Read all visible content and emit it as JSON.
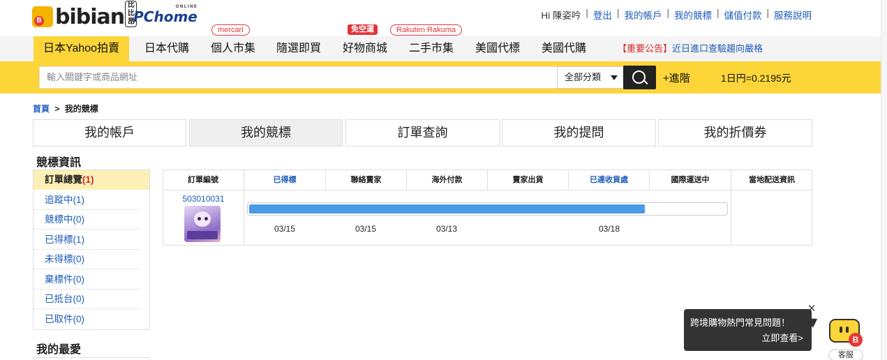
{
  "header": {
    "logo": {
      "bibian": "bibian",
      "small": "比比昂",
      "pchome": "PChome",
      "online": "ONLINE"
    },
    "greeting": "Hi 陳姿吟",
    "links": [
      "登出",
      "我的帳戶",
      "我的競標",
      "儲值付款",
      "服務說明"
    ],
    "badges": {
      "mercari": "mercari",
      "free_ship": "免空運",
      "rakuma": "Rakuten Rakuma"
    }
  },
  "nav": {
    "items": [
      "日本Yahoo拍賣",
      "日本代購",
      "個人市集",
      "隨選即買",
      "好物商城",
      "二手市集",
      "美國代標",
      "美國代購"
    ],
    "active_index": 0,
    "notice_tag": "【重要公告】",
    "notice_text": "近日進口查驗趨向嚴格"
  },
  "search": {
    "placeholder": "輸入關鍵字或商品網址",
    "category": "全部分類",
    "advanced": "+進階",
    "rate": "1日円=0.2195元"
  },
  "breadcrumb": {
    "home": "首頁",
    "sep": ">",
    "current": "我的競標"
  },
  "tabs": [
    "我的帳戶",
    "我的競標",
    "訂單查詢",
    "我的提問",
    "我的折價券"
  ],
  "sidebar": {
    "title": "競標資訊",
    "items": [
      {
        "label": "訂單總覽",
        "count": "(1)"
      },
      {
        "label": "追蹤中",
        "count": "(1)"
      },
      {
        "label": "競標中",
        "count": "(0)"
      },
      {
        "label": "已得標",
        "count": "(1)"
      },
      {
        "label": "未得標",
        "count": "(0)"
      },
      {
        "label": "棄標件",
        "count": "(0)"
      },
      {
        "label": "已抵台",
        "count": "(0)"
      },
      {
        "label": "已取件",
        "count": "(0)"
      }
    ],
    "favorites_title": "我的最愛"
  },
  "order_table": {
    "headers": [
      "訂單編號",
      "已得標",
      "聯絡賣家",
      "海外付款",
      "賣家出貨",
      "已達收貨處",
      "國際運送中",
      "當地配送資訊"
    ],
    "order_no": "503010031",
    "progress": 0.83,
    "dates": [
      "03/15",
      "03/15",
      "03/13",
      "03/18"
    ]
  },
  "help": {
    "line1": "跨境購物熱門常見問題！",
    "line2": "立即查看>",
    "close": "✕",
    "service_label": "客服",
    "badge": "B"
  },
  "colors": {
    "brand_yellow": "#fcd538",
    "link_blue": "#1c5bb8",
    "progress_blue": "#4a9ae8",
    "alert_red": "#d9252b"
  }
}
